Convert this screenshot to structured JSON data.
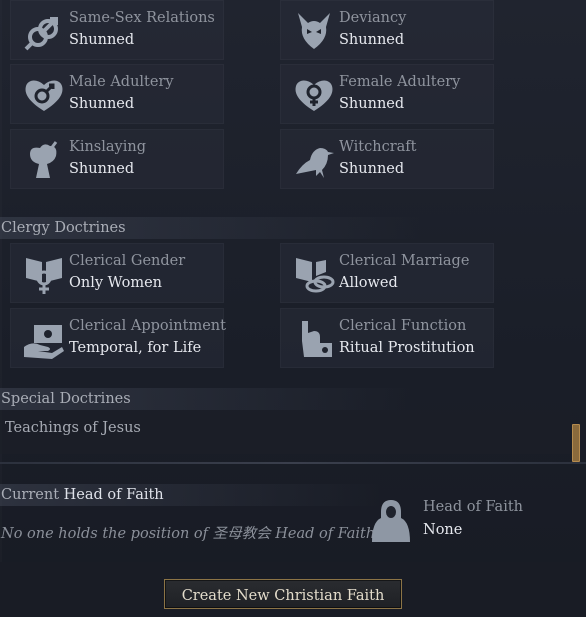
{
  "doctrines_top": [
    {
      "title": "Same-Sex Relations",
      "value": "Shunned",
      "icon": "same-sex-symbol-icon"
    },
    {
      "title": "Deviancy",
      "value": "Shunned",
      "icon": "demon-head-icon"
    },
    {
      "title": "Male Adultery",
      "value": "Shunned",
      "icon": "male-heart-icon"
    },
    {
      "title": "Female Adultery",
      "value": "Shunned",
      "icon": "female-heart-icon"
    },
    {
      "title": "Kinslaying",
      "value": "Shunned",
      "icon": "broken-tree-icon"
    },
    {
      "title": "Witchcraft",
      "value": "Shunned",
      "icon": "raven-icon"
    }
  ],
  "clergy": {
    "header": "Clergy Doctrines",
    "items": [
      {
        "title": "Clerical Gender",
        "value": "Only Women",
        "icon": "gender-book-icon"
      },
      {
        "title": "Clerical Marriage",
        "value": "Allowed",
        "icon": "book-rings-icon"
      },
      {
        "title": "Clerical Appointment",
        "value": "Temporal, for Life",
        "icon": "hand-letter-icon"
      },
      {
        "title": "Clerical Function",
        "value": "Ritual Prostitution",
        "icon": "raised-hand-figure-icon"
      }
    ]
  },
  "special": {
    "header": "Special Doctrines",
    "items": [
      "Teachings of Jesus"
    ]
  },
  "head_of_faith": {
    "header_prefix": "Current",
    "header_strong": "Head of Faith",
    "none_text": "No one holds the position of 圣母教会 Head of Faith",
    "tile_title": "Head of Faith",
    "tile_value": "None"
  },
  "create_button": "Create New Christian Faith",
  "colors": {
    "accent_gold": "#8c7446",
    "text_primary": "#e6e8ee",
    "text_muted": "#8f949e",
    "icon": "#9aa3b0"
  }
}
